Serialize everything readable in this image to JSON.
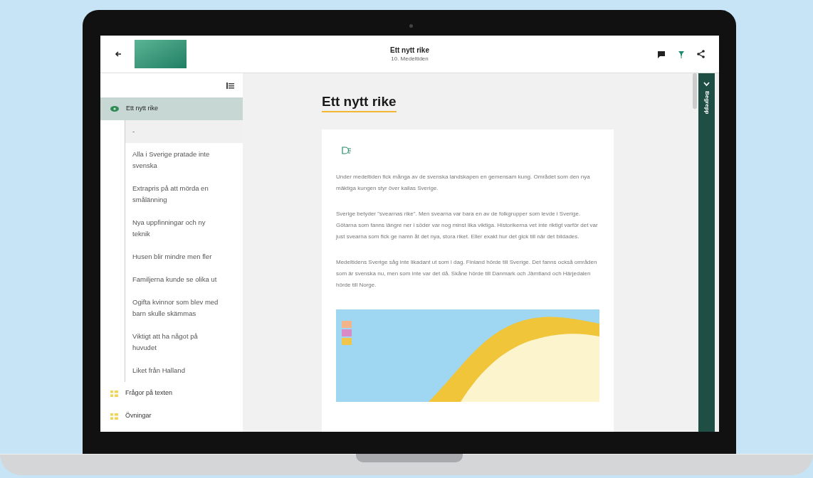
{
  "header": {
    "title": "Ett nytt rike",
    "subtitle": "10. Medeltiden"
  },
  "sidebar": {
    "items": [
      {
        "label": "Ett nytt rike",
        "selected": true,
        "kind": "chapter",
        "children": [
          {
            "label": "-",
            "selected": true
          },
          {
            "label": "Alla i Sverige pratade inte svenska",
            "selected": false
          },
          {
            "label": "Extrapris på att mörda en smålänning",
            "selected": false
          },
          {
            "label": "Nya uppfinningar och ny teknik",
            "selected": false
          },
          {
            "label": "Husen blir mindre men fler",
            "selected": false
          },
          {
            "label": "Familjerna kunde se olika ut",
            "selected": false
          },
          {
            "label": "Ogifta kvinnor som blev med barn skulle skämmas",
            "selected": false
          },
          {
            "label": "Viktigt att ha något på huvudet",
            "selected": false
          },
          {
            "label": "Liket från Halland",
            "selected": false
          }
        ]
      },
      {
        "label": "Frågor på texten",
        "selected": false,
        "kind": "task"
      },
      {
        "label": "Övningar",
        "selected": false,
        "kind": "task"
      }
    ]
  },
  "article": {
    "title": "Ett nytt rike",
    "paragraphs": [
      "Under medeltiden fick många av de svenska landskapen en gemensam kung. Området som den nya mäktiga kungen styr över kallas Sverige.",
      "Sverige betyder \"svearnas rike\". Men svearna var bara en av de folkgrupper som levde i Sverige. Götarna som fanns längre ner i söder var nog minst lika viktiga. Historikerna vet inte riktigt varför det var just svearna som fick ge namn åt det nya, stora riket. Eller exakt hur det gick till när det bildades.",
      "Medeltidens Sverige såg inte likadant ut som i dag. Finland hörde till Sverige. Det fanns också områden som är svenska nu, men som inte var det då. Skåne hörde till Danmark och Jämtland och Härjedalen hörde till Norge."
    ]
  },
  "side_tab": {
    "label": "Begrepp"
  }
}
